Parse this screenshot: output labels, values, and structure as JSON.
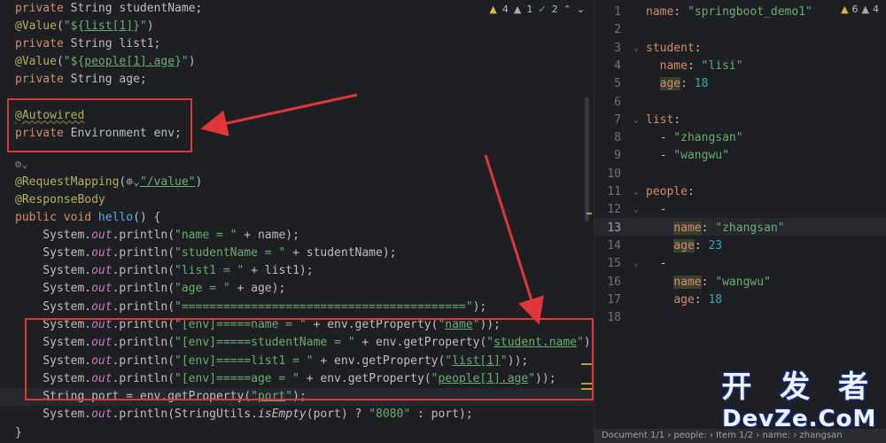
{
  "editor": {
    "inspection": {
      "warnings": "4",
      "weak_warnings": "1",
      "ok": "2"
    },
    "code_lines": [
      "private String studentName;",
      "@Value(\"${list[1]}\")",
      "private String list1;",
      "@Value(\"${people[1].age}\")",
      "private String age;",
      "",
      "@Autowired",
      "private Environment env;",
      "",
      "",
      "@RequestMapping(",
      "@ResponseBody",
      "public void hello() {",
      "    System.out.println(\"name = \" + name);",
      "    System.out.println(\"studentName = \" + studentName);",
      "    System.out.println(\"list1 = \" + list1);",
      "    System.out.println(\"age = \" + age);",
      "    System.out.println(\"=========================================\");",
      "    System.out.println(\"[env]=====name = \" + env.getProperty(\"name\"));",
      "    System.out.println(\"[env]=====studentName = \" + env.getProperty(\"student.name\"));",
      "    System.out.println(\"[env]=====list1 = \" + env.getProperty(\"list[1]\"));",
      "    System.out.println(\"[env]=====age = \" + env.getProperty(\"people[1].age\"));",
      "    String port = env.getProperty(\"port\");",
      "    System.out.println(StringUtils.isEmpty(port) ? \"8080\" : port);",
      "}"
    ],
    "request_mapping_value": "\"/value\""
  },
  "yaml": {
    "inspection": {
      "warnings": "6",
      "weak_warnings": "4"
    },
    "line_numbers": [
      "1",
      "2",
      "3",
      "4",
      "5",
      "6",
      "7",
      "8",
      "9",
      "10",
      "11",
      "12",
      "13",
      "14",
      "15",
      "16",
      "17",
      "18"
    ],
    "lines": [
      "name: \"springboot_demo1\"",
      "",
      "student:",
      "  name: \"lisi\"",
      "  age: 18",
      "",
      "list:",
      "  - \"zhangsan\"",
      "  - \"wangwu\"",
      "",
      "people:",
      "  -",
      "    name: \"zhangsan\"",
      "    age: 23",
      "  -",
      "    name: \"wangwu\"",
      "    age: 18",
      ""
    ],
    "breadcrumb": "Document 1/1  ›  people:  ›  Item 1/2  ›  name:  ›  zhangsan"
  },
  "watermark": {
    "cn": "开 发 者",
    "en": "DevZe.CoM"
  },
  "colors": {
    "annotation_box": "#e0363a",
    "background": "#1e1f22"
  }
}
